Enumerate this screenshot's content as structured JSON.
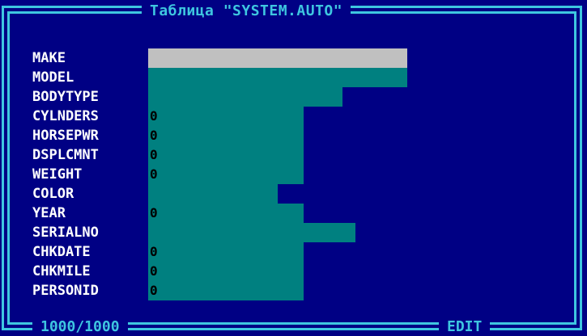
{
  "window": {
    "title": "Таблица \"SYSTEM.AUTO\""
  },
  "status": {
    "record_counter": "1000/1000",
    "mode": "EDIT"
  },
  "fields": [
    {
      "name": "MAKE",
      "value": ""
    },
    {
      "name": "MODEL",
      "value": ""
    },
    {
      "name": "BODYTYPE",
      "value": ""
    },
    {
      "name": "CYLNDERS",
      "value": "0"
    },
    {
      "name": "HORSEPWR",
      "value": "0"
    },
    {
      "name": "DSPLCMNT",
      "value": "0"
    },
    {
      "name": "WEIGHT",
      "value": "0"
    },
    {
      "name": "COLOR",
      "value": ""
    },
    {
      "name": "YEAR",
      "value": "0"
    },
    {
      "name": "SERIALNO",
      "value": ""
    },
    {
      "name": "CHKDATE",
      "value": "0"
    },
    {
      "name": "CHKMILE",
      "value": "0"
    },
    {
      "name": "PERSONID",
      "value": "0"
    }
  ],
  "colors": {
    "background": "#000084",
    "frame": "#3ec6e0",
    "field_fill": "#008080",
    "active_field_fill": "#c0c0c0",
    "label": "#ffffff"
  }
}
